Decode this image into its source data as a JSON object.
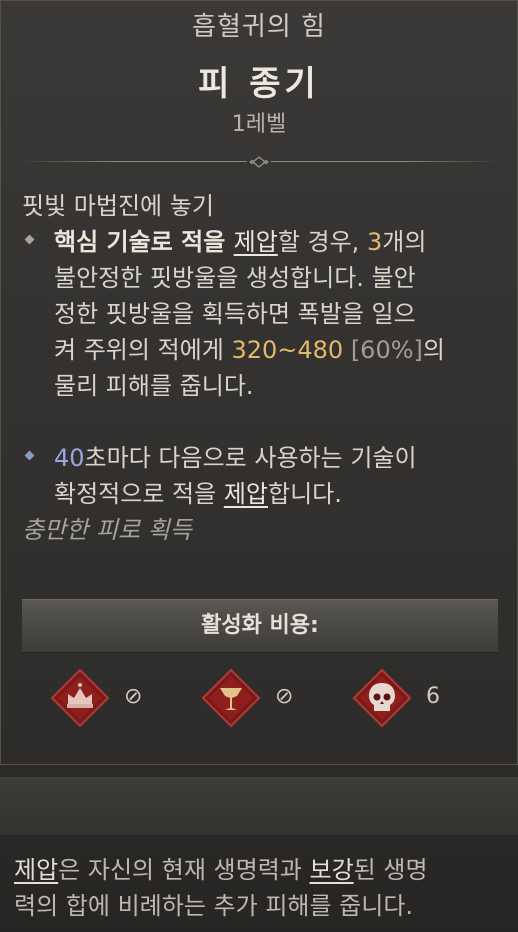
{
  "header": {
    "category": "흡혈귀의 힘",
    "skill_name": "피 종기",
    "level": "1레벨"
  },
  "description": {
    "intro": "핏빛 마법진에 놓기",
    "bullet1": {
      "line1_a": "핵심 기술로 적을 ",
      "line1_link": "제압",
      "line1_b": "할 경우, ",
      "line1_num": "3",
      "line1_c": "개의",
      "line2": "불안정한 핏방울을 생성합니다. 불안",
      "line3": "정한 핏방울을 획득하면 폭발을 일으",
      "line4_a": "켜 주위의 적에게 ",
      "line4_num": "320~480",
      "line4_pct": " [60%]",
      "line4_b": "의",
      "line5": "물리 피해를 줍니다."
    },
    "bullet2": {
      "line1_num": "40",
      "line1_a": "초마다 다음으로 사용하는 기술이",
      "line2_a": "확정적으로 적을 ",
      "line2_link": "제압",
      "line2_b": "합니다."
    },
    "flavor": "충만한 피로 획득"
  },
  "activation": {
    "label": "활성화 비용:",
    "costs": [
      {
        "icon": "crown-sigil-icon",
        "value": "⊘"
      },
      {
        "icon": "chalice-sigil-icon",
        "value": "⊘"
      },
      {
        "icon": "skull-sigil-icon",
        "value": "6"
      }
    ]
  },
  "footnote": {
    "term1": "제압",
    "text1": "은 자신의 현재 생명력과 ",
    "term2": "보강",
    "text2": "된 생명",
    "line2": "력의 합에 비례하는 추가 피해를 줍니다."
  },
  "colors": {
    "accent_orange": "#e2b86a",
    "accent_blue": "#9ba6de",
    "sigil_red": "#8e1f1c"
  }
}
